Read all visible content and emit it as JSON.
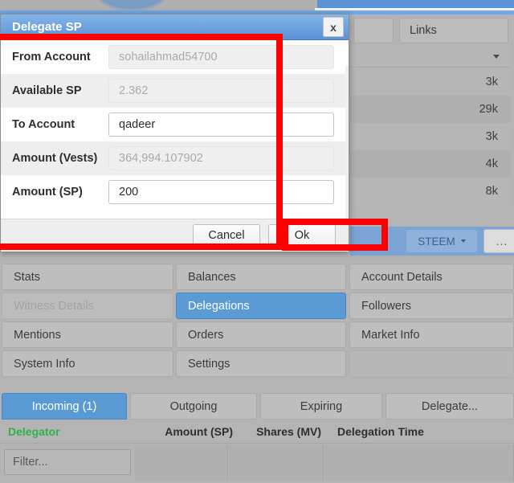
{
  "background": {
    "links_button": "Links",
    "side_values": [
      "3k",
      "29k",
      "3k",
      "4k",
      "8k"
    ],
    "toolbar": {
      "currency": "STEEM",
      "more_label": "..."
    }
  },
  "nav_grid": {
    "items": [
      {
        "label": "Stats",
        "state": "normal"
      },
      {
        "label": "Balances",
        "state": "normal"
      },
      {
        "label": "Account Details",
        "state": "normal"
      },
      {
        "label": "Witness Details",
        "state": "disabled"
      },
      {
        "label": "Delegations",
        "state": "active"
      },
      {
        "label": "Followers",
        "state": "normal"
      },
      {
        "label": "Mentions",
        "state": "normal"
      },
      {
        "label": "Orders",
        "state": "normal"
      },
      {
        "label": "Market Info",
        "state": "normal"
      },
      {
        "label": "System Info",
        "state": "normal"
      },
      {
        "label": "Settings",
        "state": "normal"
      }
    ]
  },
  "tabs": [
    {
      "label": "Incoming (1)",
      "active": true
    },
    {
      "label": "Outgoing",
      "active": false
    },
    {
      "label": "Expiring",
      "active": false
    },
    {
      "label": "Delegate...",
      "active": false
    }
  ],
  "table": {
    "headers": [
      "Delegator",
      "Amount (SP)",
      "Shares (MV)",
      "Delegation Time"
    ],
    "filter_placeholder": "Filter...",
    "rows": []
  },
  "dialog": {
    "title": "Delegate SP",
    "close_label": "x",
    "fields": [
      {
        "label": "From Account",
        "value": "sohailahmad54700",
        "enabled": false
      },
      {
        "label": "Available SP",
        "value": "2.362",
        "enabled": false
      },
      {
        "label": "To Account",
        "value": "qadeer",
        "enabled": true
      },
      {
        "label": "Amount (Vests)",
        "value": "364,994.107902",
        "enabled": false
      },
      {
        "label": "Amount (SP)",
        "value": "200",
        "enabled": true
      }
    ],
    "cancel_label": "Cancel",
    "ok_label": "Ok"
  },
  "colors": {
    "accent_blue": "#5b9bd5",
    "annotation_red": "#ff0000",
    "delegator_green": "#2fb34a"
  }
}
